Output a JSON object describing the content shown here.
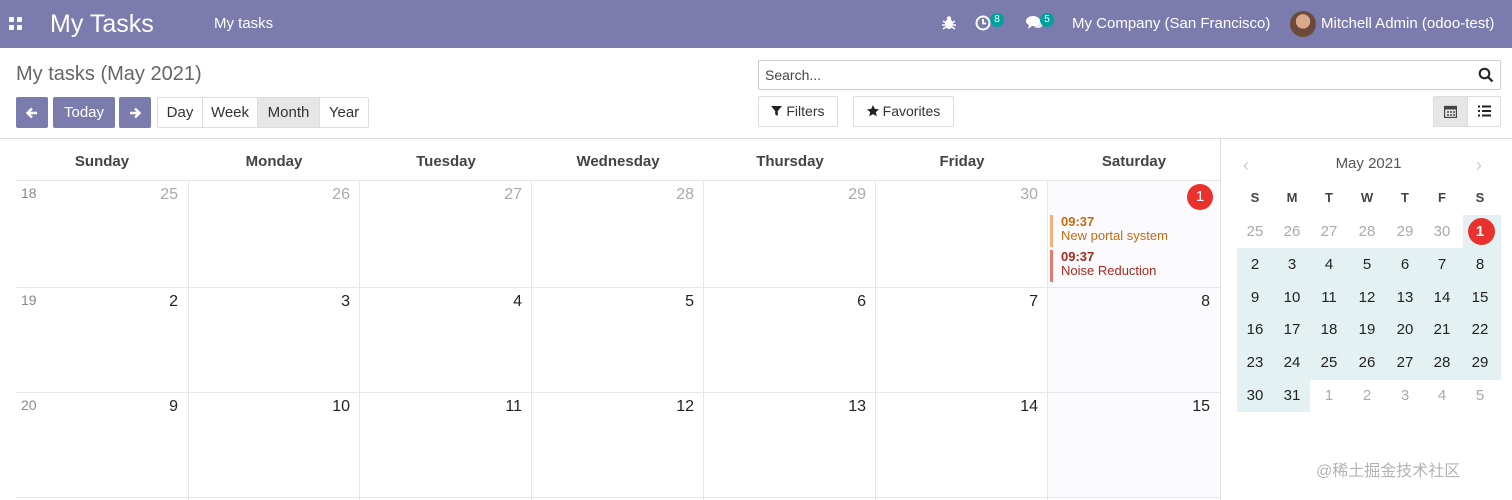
{
  "navbar": {
    "app_title": "My Tasks",
    "menu_item": "My tasks",
    "activity_count": "8",
    "message_count": "5",
    "company": "My Company (San Francisco)",
    "user": "Mitchell Admin (odoo-test)",
    "color": "#7c7bad"
  },
  "control_panel": {
    "title": "My tasks (May 2021)",
    "today_label": "Today",
    "scales": [
      "Day",
      "Week",
      "Month",
      "Year"
    ],
    "active_scale": "Month",
    "search_placeholder": "Search...",
    "filters_label": "Filters",
    "favorites_label": "Favorites"
  },
  "calendar": {
    "weekdays": [
      "Sunday",
      "Monday",
      "Tuesday",
      "Wednesday",
      "Thursday",
      "Friday",
      "Saturday"
    ],
    "weeks": [
      {
        "number": "18",
        "days": [
          "25",
          "26",
          "27",
          "28",
          "29",
          "30",
          "1"
        ]
      },
      {
        "number": "19",
        "days": [
          "2",
          "3",
          "4",
          "5",
          "6",
          "7",
          "8"
        ]
      },
      {
        "number": "20",
        "days": [
          "9",
          "10",
          "11",
          "12",
          "13",
          "14",
          "15"
        ]
      }
    ],
    "events": [
      {
        "time": "09:37",
        "title": "New portal system",
        "color": "#c26b14"
      },
      {
        "time": "09:37",
        "title": "Noise Reduction",
        "color": "#a52a1f"
      }
    ],
    "today_color": "#e9322d"
  },
  "mini_calendar": {
    "title": "May 2021",
    "dow": [
      "S",
      "M",
      "T",
      "W",
      "T",
      "F",
      "S"
    ],
    "rows": [
      [
        "25",
        "26",
        "27",
        "28",
        "29",
        "30",
        "1"
      ],
      [
        "2",
        "3",
        "4",
        "5",
        "6",
        "7",
        "8"
      ],
      [
        "9",
        "10",
        "11",
        "12",
        "13",
        "14",
        "15"
      ],
      [
        "16",
        "17",
        "18",
        "19",
        "20",
        "21",
        "22"
      ],
      [
        "23",
        "24",
        "25",
        "26",
        "27",
        "28",
        "29"
      ],
      [
        "30",
        "31",
        "1",
        "2",
        "3",
        "4",
        "5"
      ]
    ],
    "highlight_color": "#e3f1f2"
  },
  "watermark": "@稀土掘金技术社区"
}
